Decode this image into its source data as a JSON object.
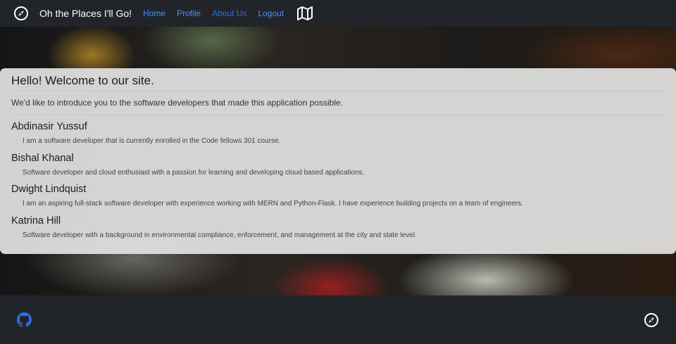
{
  "navbar": {
    "brand_icon": "compass-icon",
    "title": "Oh the Places I'll Go!",
    "links": [
      "Home",
      "Profile",
      "About Us",
      "Logout"
    ],
    "map_icon": "map-icon"
  },
  "welcome": {
    "title": "Hello! Welcome to our site.",
    "intro": "We'd like to introduce you to the software developers that made this application possible.",
    "developers": [
      {
        "name": "Abdinasir Yussuf",
        "bio": "I am a software developer that is currently enrolled in the Code fellows 301 course."
      },
      {
        "name": "Bishal Khanal",
        "bio": "Software developer and cloud enthusiast with a passion for learning and developing cloud based applications."
      },
      {
        "name": "Dwight Lindquist",
        "bio": "I am an aspiring full-stack software developer with experience working with MERN and Python-Flask. I have experience building projects on a team of engineers."
      },
      {
        "name": "Katrina Hill",
        "bio": "Software developer with a background in environmental compliance, enforcement, and management at the city and state level."
      }
    ]
  },
  "footer": {
    "github_icon": "github-icon",
    "compass_icon": "compass-icon"
  },
  "colors": {
    "navbar_bg": "#212529",
    "link_active": "#4a8dff",
    "link_dim": "#2f6ee0",
    "github_blue": "#2f6ee0"
  }
}
